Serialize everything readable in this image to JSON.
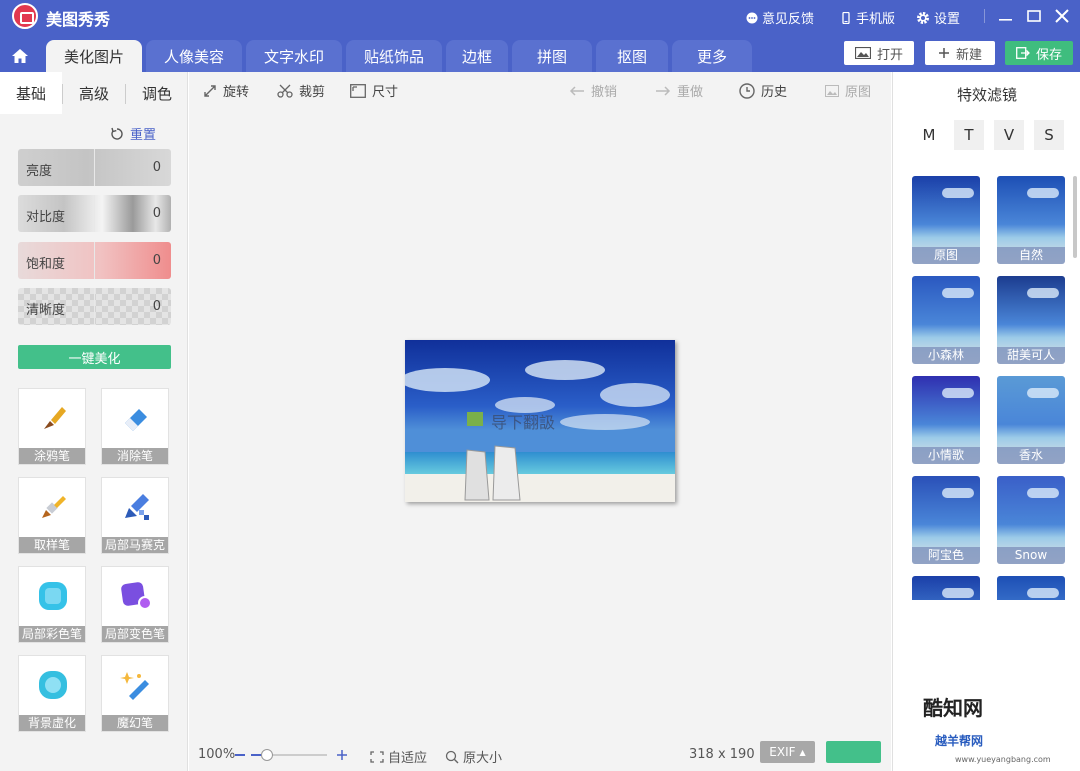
{
  "app": {
    "title": "美图秀秀"
  },
  "titlebar": {
    "feedback": "意见反馈",
    "mobile": "手机版",
    "settings": "设置"
  },
  "tabs": [
    {
      "label": "美化图片",
      "active": true
    },
    {
      "label": "人像美容"
    },
    {
      "label": "文字水印"
    },
    {
      "label": "贴纸饰品"
    },
    {
      "label": "边框"
    },
    {
      "label": "拼图"
    },
    {
      "label": "抠图"
    },
    {
      "label": "更多"
    }
  ],
  "actions": {
    "open": "打开",
    "new": "新建",
    "save": "保存"
  },
  "left": {
    "subtabs": [
      "基础",
      "高级",
      "调色"
    ],
    "reset": "重置",
    "sliders": [
      {
        "label": "亮度",
        "value": "0"
      },
      {
        "label": "对比度",
        "value": "0"
      },
      {
        "label": "饱和度",
        "value": "0"
      },
      {
        "label": "清晰度",
        "value": "0"
      }
    ],
    "one_click": "一键美化",
    "tools": [
      "涂鸦笔",
      "消除笔",
      "取样笔",
      "局部马赛克",
      "局部彩色笔",
      "局部变色笔",
      "背景虚化",
      "魔幻笔"
    ]
  },
  "canvas": {
    "tools": {
      "rotate": "旋转",
      "crop": "裁剪",
      "size": "尺寸",
      "undo": "撤销",
      "redo": "重做",
      "history": "历史",
      "original": "原图"
    },
    "photo_text": "导下翻訯",
    "zoom": "100%",
    "fit": "自适应",
    "actual": "原大小",
    "dimensions": "318 x 190",
    "exif": "EXIF"
  },
  "right": {
    "title": "特效滤镜",
    "letters": [
      "M",
      "T",
      "V",
      "S"
    ],
    "filters": [
      "原图",
      "自然",
      "小森林",
      "甜美可人",
      "小情歌",
      "香水",
      "阿宝色",
      "Snow"
    ]
  },
  "watermark": {
    "site": "酷知网",
    "site2": "越羊帮网",
    "url": "www.yueyangbang.com"
  }
}
